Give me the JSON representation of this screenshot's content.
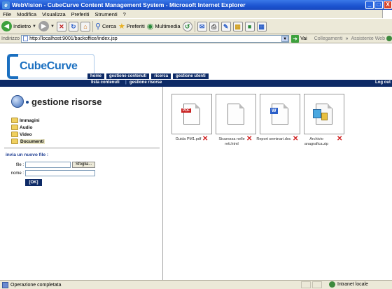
{
  "window": {
    "title": "WebVision - CubeCurve Content Management System - Microsoft Internet Explorer",
    "controls": {
      "minimize": "_",
      "maximize": "□",
      "close": "X"
    }
  },
  "menu": [
    "File",
    "Modifica",
    "Visualizza",
    "Preferiti",
    "Strumenti",
    "?"
  ],
  "toolbar": {
    "back": "Indietro",
    "search": "Cerca",
    "favorites": "Preferiti",
    "media": "Multimedia"
  },
  "address": {
    "label": "Indirizzo",
    "url": "http://localhost:9001/backoffice/index.jsp",
    "go": "Vai",
    "links": "Collegamenti",
    "assistant": "Assistente Web"
  },
  "app": {
    "logo": "CubeCurve",
    "nav": [
      "home",
      "gestione contenuti",
      "ricerca",
      "gestione utenti"
    ],
    "subnav": [
      "lista contenuti",
      "gestione risorse"
    ],
    "logout": "Log out"
  },
  "panel": {
    "title": "gestione risorse",
    "folders": [
      "Immagini",
      "Audio",
      "Video",
      "Documenti"
    ],
    "active_folder": "Documenti"
  },
  "upload": {
    "title": "invia un nuovo file :",
    "file_label": "file :",
    "browse": "Sfoglia...",
    "name_label": "nome :",
    "ok": "[OK]"
  },
  "files": [
    {
      "name": "Guida PM1.pdf",
      "type": "pdf-icon",
      "badge": "PDF"
    },
    {
      "name": "Sicurezza nelle reti.html",
      "type": "html-icon",
      "badge": ""
    },
    {
      "name": "Report seminari.doc",
      "type": "word-icon",
      "badge": "W"
    },
    {
      "name": "Archivio anagrafica.zip",
      "type": "zip-icon",
      "badge": ""
    }
  ],
  "status": {
    "text": "Operazione completata",
    "zone": "Intranet locale"
  }
}
